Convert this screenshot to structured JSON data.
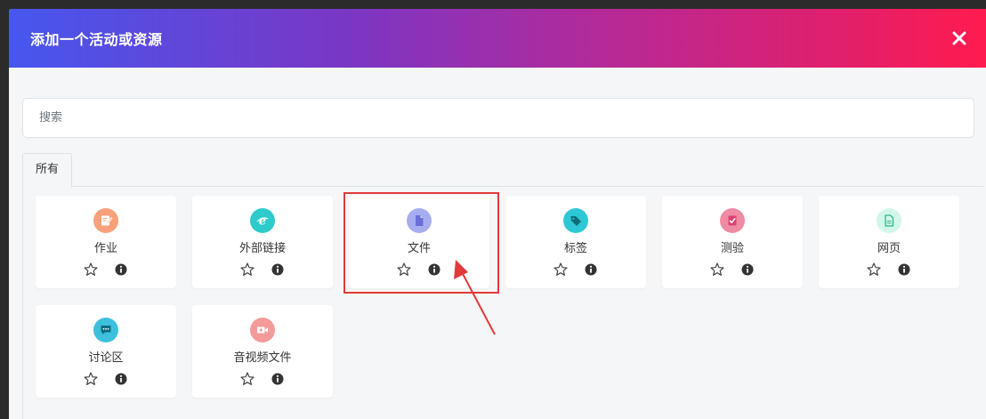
{
  "modal": {
    "title": "添加一个活动或资源"
  },
  "search": {
    "placeholder": "搜索"
  },
  "tabs": [
    {
      "label": "所有"
    }
  ],
  "cards": [
    {
      "label": "作业",
      "icon": "assignment-icon",
      "color": "#f7a07a"
    },
    {
      "label": "外部链接",
      "icon": "external-link-icon",
      "color": "#2dcbcb"
    },
    {
      "label": "文件",
      "icon": "file-icon",
      "color": "#a7aef0"
    },
    {
      "label": "标签",
      "icon": "tag-icon",
      "color": "#2ec7d6"
    },
    {
      "label": "测验",
      "icon": "quiz-icon",
      "color": "#f08ba4"
    },
    {
      "label": "网页",
      "icon": "page-icon",
      "color": "#4fd4a6"
    },
    {
      "label": "讨论区",
      "icon": "forum-icon",
      "color": "#3cc0dc"
    },
    {
      "label": "音视频文件",
      "icon": "video-icon",
      "color": "#f59a9a"
    }
  ],
  "colors": {
    "header_start": "#4657ee",
    "header_end": "#ff1b4e",
    "highlight": "#e23a3a"
  }
}
